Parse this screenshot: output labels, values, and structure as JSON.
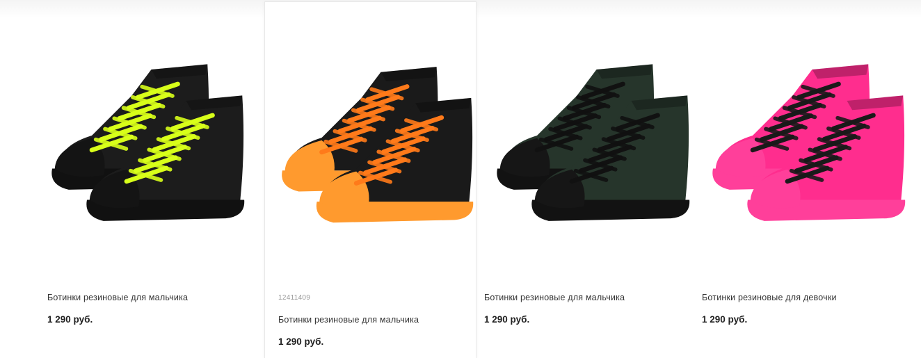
{
  "products": [
    {
      "title": "Ботинки резиновые для мальчика",
      "price": "1 290 руб.",
      "image": "shoe-image",
      "colors": {
        "body": "#1c1c1c",
        "sole": "#111111",
        "laces": "#d8ff1a",
        "cap": "#141414"
      }
    },
    {
      "sku": "12411409",
      "title": "Ботинки резиновые для мальчика",
      "price": "1 290 руб.",
      "image": "shoe-image",
      "colors": {
        "body": "#1a1a1a",
        "sole": "#ff9a2e",
        "laces": "#ff7a1a",
        "cap": "#ff9a2e"
      }
    },
    {
      "title": "Ботинки резиновые для мальчика",
      "price": "1 290 руб.",
      "image": "shoe-image",
      "colors": {
        "body": "#26352b",
        "sole": "#121212",
        "laces": "#111111",
        "cap": "#161616"
      }
    },
    {
      "title": "Ботинки резиновые для девочки",
      "price": "1 290 руб.",
      "image": "shoe-image",
      "colors": {
        "body": "#ff2d8e",
        "sole": "#ff3f9a",
        "laces": "#1a1a1a",
        "cap": "#ff3f9a"
      }
    }
  ]
}
